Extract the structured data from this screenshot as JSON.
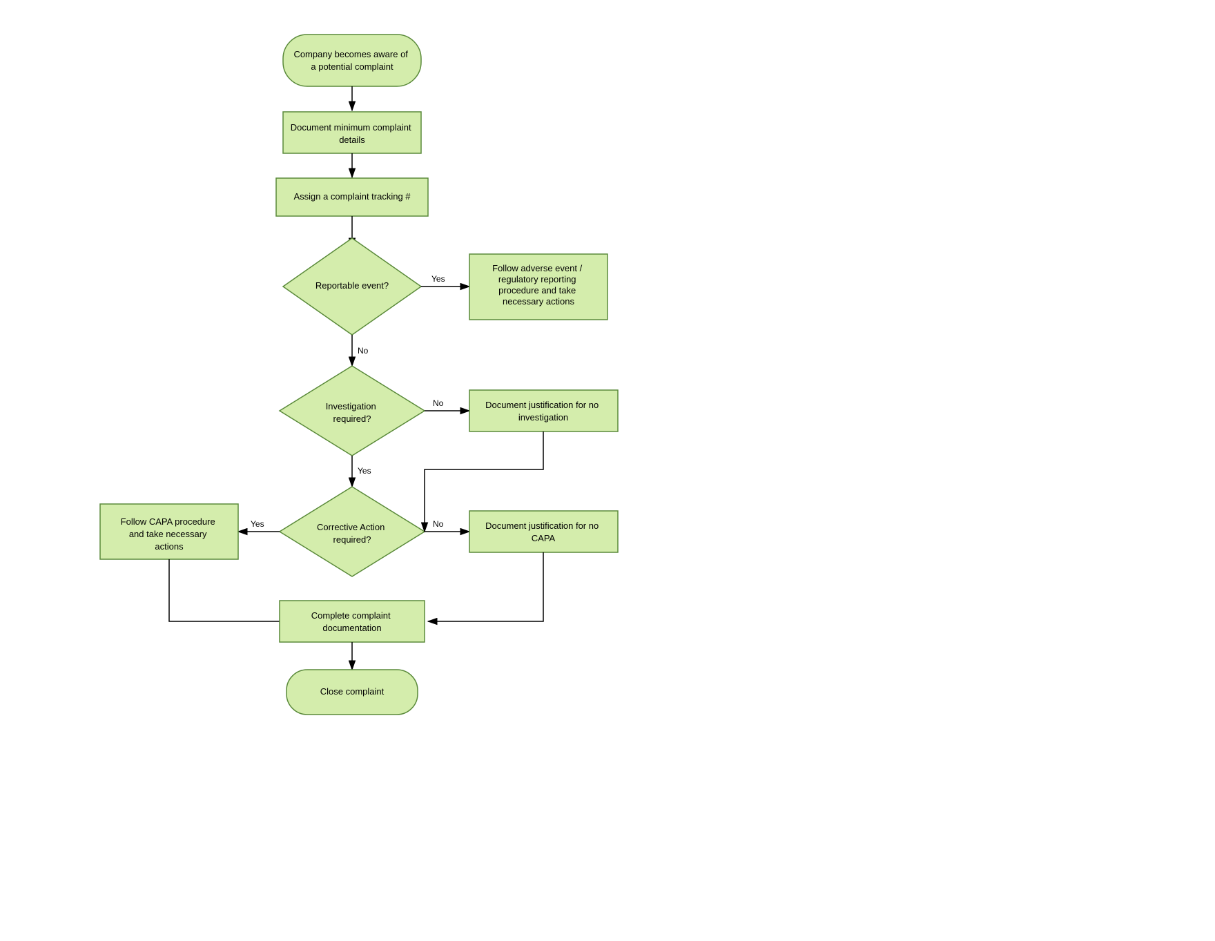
{
  "nodes": {
    "start": {
      "label_line1": "Company becomes aware of",
      "label_line2": "a potential complaint"
    },
    "doc_min": {
      "label_line1": "Document minimum complaint",
      "label_line2": "details"
    },
    "assign_tracking": {
      "label_line1": "Assign a complaint tracking #"
    },
    "reportable": {
      "label_line1": "Reportable event?"
    },
    "adverse_event": {
      "label_line1": "Follow adverse event /",
      "label_line2": "regulatory reporting",
      "label_line3": "procedure and take",
      "label_line4": "necessary actions"
    },
    "investigation": {
      "label_line1": "Investigation",
      "label_line2": "required?"
    },
    "no_investigation": {
      "label_line1": "Document justification for no",
      "label_line2": "investigation"
    },
    "corrective_action": {
      "label_line1": "Corrective Action",
      "label_line2": "required?"
    },
    "follow_capa": {
      "label_line1": "Follow CAPA procedure",
      "label_line2": "and take necessary",
      "label_line3": "actions"
    },
    "no_capa": {
      "label_line1": "Document justification for no",
      "label_line2": "CAPA"
    },
    "complete_doc": {
      "label_line1": "Complete complaint",
      "label_line2": "documentation"
    },
    "close": {
      "label_line1": "Close complaint"
    }
  },
  "labels": {
    "yes": "Yes",
    "no": "No"
  }
}
